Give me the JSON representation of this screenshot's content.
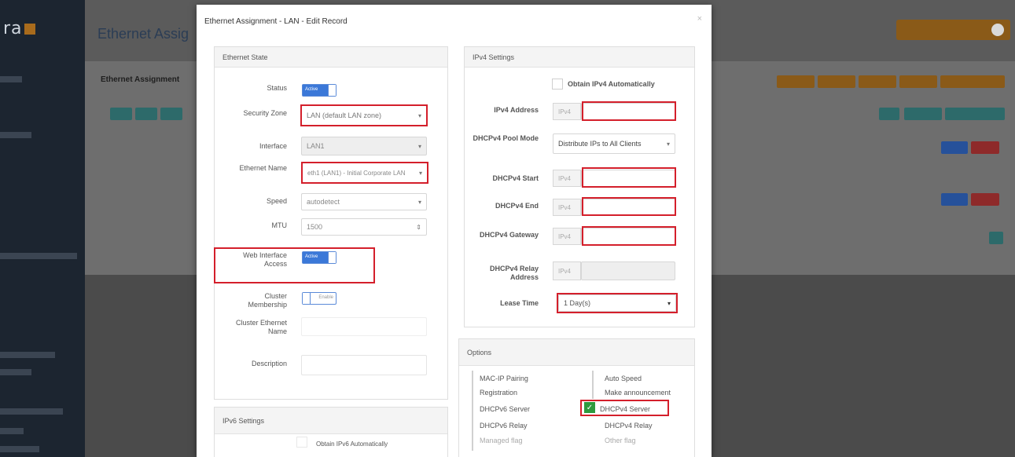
{
  "app": {
    "logo": "ra",
    "page_title": "Ethernet Assig",
    "breadcrumb": "Ethernet Assignment"
  },
  "modal": {
    "title": "Ethernet Assignment - LAN - Edit Record",
    "ethernet_state": {
      "header": "Ethernet State",
      "status_label": "Status",
      "status_value": "Active",
      "security_zone_label": "Security Zone",
      "security_zone_value": "LAN (default LAN zone)",
      "interface_label": "Interface",
      "interface_value": "LAN1",
      "ethernet_name_label": "Ethernet Name",
      "ethernet_name_value": "eth1 (LAN1) - Initial Corporate LAN",
      "speed_label": "Speed",
      "speed_value": "autodetect",
      "mtu_label": "MTU",
      "mtu_value": "1500",
      "web_access_label": "Web Interface Access",
      "web_access_value": "Active",
      "cluster_membership_label": "Cluster Membership",
      "cluster_membership_value": "Enable",
      "cluster_ethernet_name_label": "Cluster Ethernet Name",
      "description_label": "Description"
    },
    "ipv6_settings": {
      "header": "IPv6 Settings",
      "obtain_label": "Obtain IPv6 Automatically"
    },
    "ipv4_settings": {
      "header": "IPv4 Settings",
      "obtain_label": "Obtain IPv4 Automatically",
      "ipv4_address_label": "IPv4 Address",
      "addon": "IPv4",
      "dhcp_pool_mode_label": "DHCPv4 Pool Mode",
      "dhcp_pool_mode_value": "Distribute IPs to All Clients",
      "dhcp_start_label": "DHCPv4 Start",
      "dhcp_end_label": "DHCPv4 End",
      "dhcp_gateway_label": "DHCPv4 Gateway",
      "dhcp_relay_label": "DHCPv4 Relay Address",
      "lease_time_label": "Lease Time",
      "lease_time_value": "1 Day(s)"
    },
    "options": {
      "header": "Options",
      "items": [
        {
          "label": "MAC-IP Pairing",
          "checked": false,
          "dim": false
        },
        {
          "label": "Auto Speed",
          "checked": false,
          "dim": false
        },
        {
          "label": "Registration",
          "checked": false,
          "dim": false
        },
        {
          "label": "Make announcement",
          "checked": false,
          "dim": false
        },
        {
          "label": "DHCPv6 Server",
          "checked": false,
          "dim": false
        },
        {
          "label": "DHCPv4 Server",
          "checked": true,
          "dim": false
        },
        {
          "label": "DHCPv6 Relay",
          "checked": false,
          "dim": false
        },
        {
          "label": "DHCPv4 Relay",
          "checked": false,
          "dim": false
        },
        {
          "label": "Managed flag",
          "checked": false,
          "dim": true
        },
        {
          "label": "Other flag",
          "checked": false,
          "dim": true
        }
      ]
    }
  },
  "colors": {
    "highlight": "#d41f2b",
    "toggle_active": "#3b78d8",
    "checkbox_checked": "#2e9a3e"
  }
}
